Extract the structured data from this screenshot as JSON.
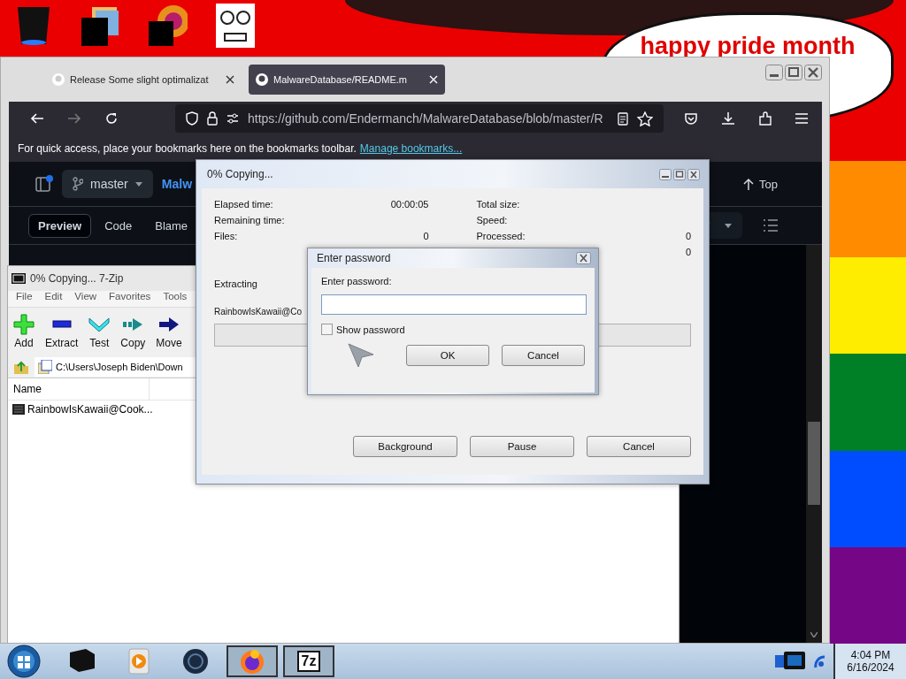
{
  "desktop": {
    "bubble_text": "happy pride month"
  },
  "browser": {
    "tabs": [
      {
        "title": "Release Some slight optimalizat",
        "selected": false
      },
      {
        "title": "MalwareDatabase/README.m",
        "selected": true
      }
    ],
    "url": "https://github.com/Endermanch/MalwareDatabase/blob/master/R",
    "bookmarks_hint": "For quick access, place your bookmarks here on the bookmarks toolbar.",
    "bookmarks_link": "Manage bookmarks...",
    "branch": "master",
    "repo_title": "Malw",
    "top_link": "Top",
    "view_tabs": [
      {
        "label": "Preview",
        "selected": true
      },
      {
        "label": "Code",
        "selected": false
      },
      {
        "label": "Blame",
        "selected": false
      }
    ]
  },
  "zip_window": {
    "title": "0% Copying... 7-Zip",
    "menu": [
      "File",
      "Edit",
      "View",
      "Favorites",
      "Tools"
    ],
    "toolbar": [
      {
        "kind": "add",
        "label": "Add"
      },
      {
        "kind": "extract",
        "label": "Extract"
      },
      {
        "kind": "test",
        "label": "Test"
      },
      {
        "kind": "copy",
        "label": "Copy"
      },
      {
        "kind": "move",
        "label": "Move"
      }
    ],
    "path": "C:\\Users\\Joseph Biden\\Down",
    "columns": [
      "Name"
    ],
    "rows": [
      {
        "name": "RainbowIsKawaii@Cook..."
      }
    ]
  },
  "copy_dialog": {
    "title": "0% Copying...",
    "left_stats": [
      {
        "label": "Elapsed time:",
        "value": "00:00:05"
      },
      {
        "label": "Remaining time:"
      },
      {
        "label": "Files:",
        "value": "0"
      }
    ],
    "right_stats": [
      {
        "label": "Total size:"
      },
      {
        "label": "Speed:"
      },
      {
        "label": "Processed:",
        "value": "0"
      },
      {
        "value": "0"
      }
    ],
    "operation": "Extracting",
    "file": "RainbowIsKawaii@Co",
    "progress": {
      "level": 0
    },
    "buttons": [
      "Background",
      "Pause",
      "Cancel"
    ]
  },
  "password_dialog": {
    "title": "Enter password",
    "label": "Enter password:",
    "show_password": {
      "label": "Show password",
      "checked": false
    },
    "buttons": [
      "OK",
      "Cancel"
    ]
  },
  "taskbar": {
    "apps": [
      {
        "kind": "box",
        "selected": false
      },
      {
        "kind": "media",
        "selected": false
      },
      {
        "kind": "globe",
        "selected": false
      },
      {
        "kind": "firefox",
        "selected": true
      },
      {
        "kind": "zip",
        "label": "7z",
        "selected": true
      }
    ],
    "time": "4:04 PM",
    "date": "6/16/2024"
  }
}
